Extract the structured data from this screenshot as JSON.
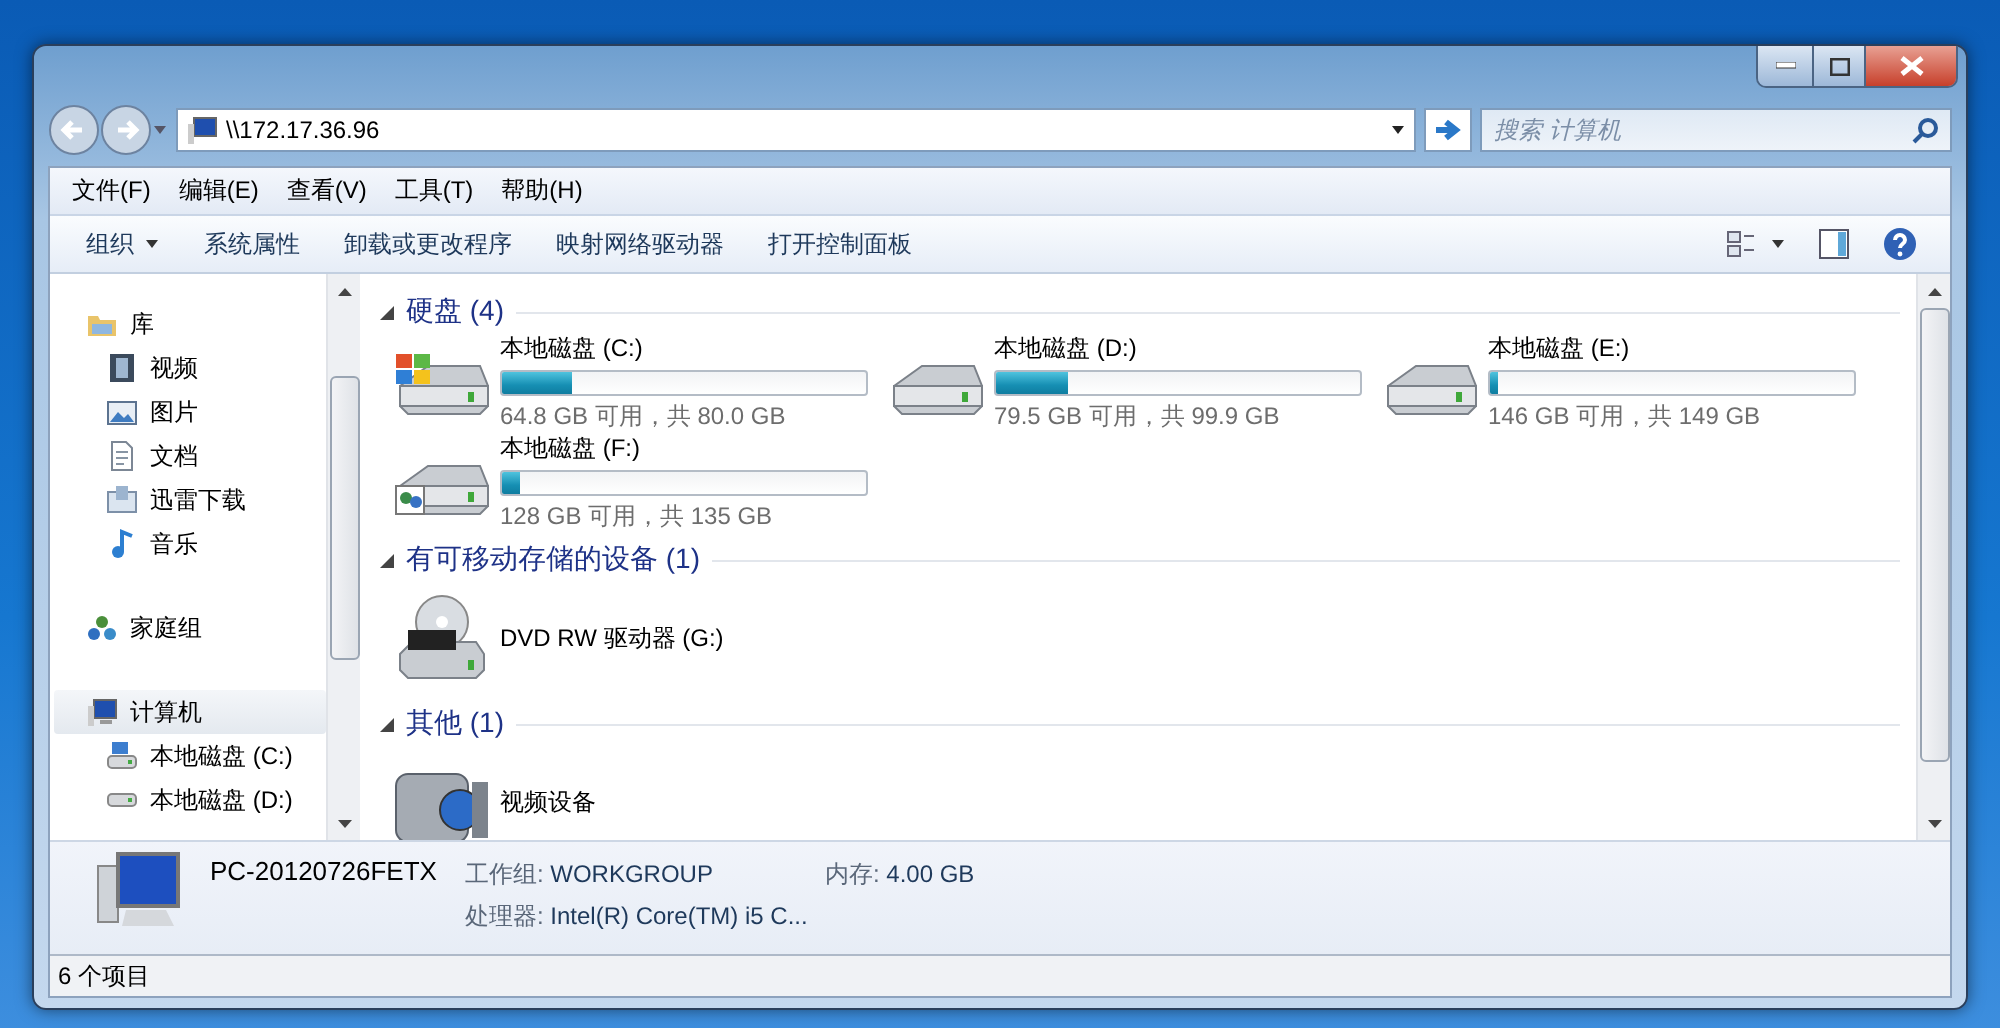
{
  "address": {
    "path": "\\\\172.17.36.96"
  },
  "search": {
    "placeholder": "搜索 计算机"
  },
  "menu": [
    "文件(F)",
    "编辑(E)",
    "查看(V)",
    "工具(T)",
    "帮助(H)"
  ],
  "toolbar": [
    {
      "label": "组织",
      "dropdown": true
    },
    {
      "label": "系统属性",
      "dropdown": false
    },
    {
      "label": "卸载或更改程序",
      "dropdown": false
    },
    {
      "label": "映射网络驱动器",
      "dropdown": false
    },
    {
      "label": "打开控制面板",
      "dropdown": false
    }
  ],
  "sidebar": [
    {
      "label": "库",
      "selected": false,
      "children": [
        {
          "label": "视频",
          "selected": false
        },
        {
          "label": "图片",
          "selected": false
        },
        {
          "label": "文档",
          "selected": false
        },
        {
          "label": "迅雷下载",
          "selected": false
        },
        {
          "label": "音乐",
          "selected": false
        }
      ]
    },
    {
      "label": "家庭组",
      "selected": false
    },
    {
      "label": "计算机",
      "selected": true,
      "children": [
        {
          "label": "本地磁盘 (C:)",
          "selected": false
        },
        {
          "label": "本地磁盘 (D:)",
          "selected": false
        }
      ]
    }
  ],
  "sections": [
    {
      "title": "硬盘 (4)",
      "expanded": true,
      "items": [
        {
          "kind": "system-disk",
          "name": "本地磁盘 (C:)",
          "level": 0.19,
          "free": "64.8 GB 可用，共 80.0 GB"
        },
        {
          "kind": "disk",
          "name": "本地磁盘 (D:)",
          "level": 0.2,
          "free": "79.5 GB 可用，共 99.9 GB"
        },
        {
          "kind": "disk",
          "name": "本地磁盘 (E:)",
          "level": 0.02,
          "free": "146 GB 可用，共 149 GB"
        },
        {
          "kind": "shared-disk",
          "name": "本地磁盘 (F:)",
          "level": 0.05,
          "free": "128 GB 可用，共 135 GB"
        }
      ]
    },
    {
      "title": "有可移动存储的设备 (1)",
      "expanded": true,
      "items": [
        {
          "kind": "dvd",
          "name": "DVD RW 驱动器 (G:)"
        }
      ]
    },
    {
      "title": "其他 (1)",
      "expanded": true,
      "items": [
        {
          "kind": "camera",
          "name": "视频设备"
        }
      ]
    }
  ],
  "details": {
    "name": "PC-20120726FETX",
    "fields": [
      {
        "label": "工作组:",
        "value": "WORKGROUP"
      },
      {
        "label": "内存:",
        "value": "4.00 GB"
      },
      {
        "label": "处理器:",
        "value": "Intel(R) Core(TM) i5 C..."
      }
    ]
  },
  "status": "6 个项目"
}
